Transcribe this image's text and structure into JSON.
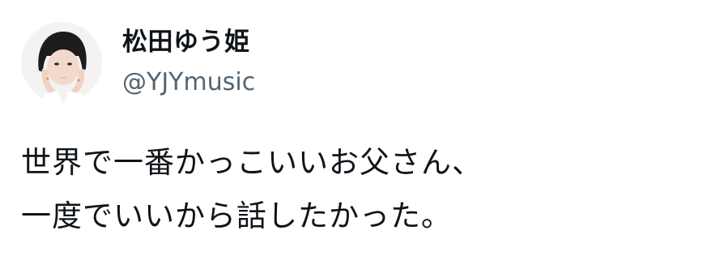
{
  "tweet": {
    "author": {
      "display_name": "松田ゆう姫",
      "handle": "@YJYmusic",
      "avatar_icon": "profile-photo"
    },
    "text_lines": [
      "世界で一番かっこいいお父さん、",
      "一度でいいから話したかった。"
    ]
  },
  "colors": {
    "text_primary": "#0f1419",
    "text_secondary": "#536471",
    "background": "#ffffff"
  }
}
